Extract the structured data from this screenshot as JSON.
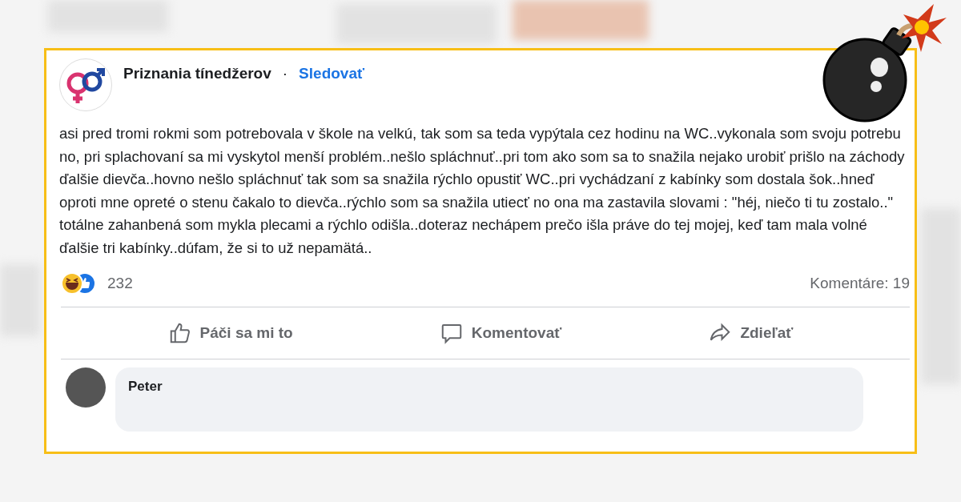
{
  "post": {
    "page_name": "Priznania tínedžerov",
    "separator": "·",
    "follow": "Sledovať",
    "text": "asi pred tromi rokmi som potrebovala v škole na velkú, tak som sa teda vypýtala cez hodinu na WC..vykonala som svoju potrebu no, pri splachovaní sa mi vyskytol menší problém..nešlo spláchnuť..pri tom ako som sa to snažila nejako urobiť prišlo na záchody ďalšie dievča..hovno nešlo spláchnuť tak som sa snažila rýchlo opustiť WC..pri vychádzaní z kabínky som dostala šok..hneď oproti mne opreté o stenu čakalo to dievča..rýchlo som sa snažila utiecť no ona ma zastavila slovami : \"héj, niečo ti tu zostalo..\" totálne zahanbená som mykla plecami a rýchlo odišla..doteraz nechápem prečo išla práve do tej mojej, keď tam mala volné ďalšie tri kabínky..dúfam, že si to už nepamätá..",
    "reaction_count": "232",
    "comments_count": "Komentáre: 19"
  },
  "actions": [
    {
      "kind": "like",
      "label": "Páči sa mi to"
    },
    {
      "kind": "comment",
      "label": "Komentovať"
    },
    {
      "kind": "share",
      "label": "Zdieľať"
    }
  ],
  "comments": [
    {
      "author": "Peter"
    }
  ]
}
